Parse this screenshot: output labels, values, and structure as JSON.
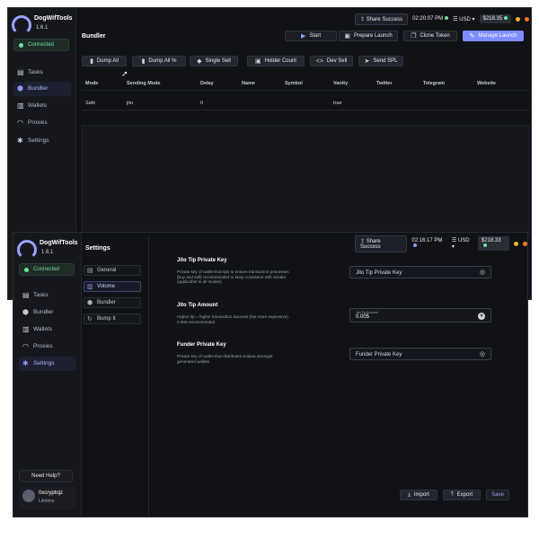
{
  "app": {
    "name": "DogWifTools",
    "version": "1.6.1",
    "status": "Connected",
    "accent": "#7f8cff"
  },
  "window_top": {
    "topbar": {
      "share": "Share Success",
      "clock": "02:20:07 PM",
      "currency": "USD",
      "balance": "$218.35"
    },
    "nav": [
      {
        "label": "Tasks",
        "icon": "tasks-icon"
      },
      {
        "label": "Bundler",
        "icon": "bundler-icon"
      },
      {
        "label": "Wallets",
        "icon": "wallets-icon"
      },
      {
        "label": "Proxies",
        "icon": "proxies-icon"
      },
      {
        "label": "Settings",
        "icon": "settings-icon"
      }
    ],
    "page_title": "Bundler",
    "header_buttons": {
      "start": "Start",
      "prepare": "Prepare Launch",
      "clone": "Clone Token",
      "manage": "Manage Launch"
    },
    "toolbar": {
      "dump_all": "Dump All",
      "dump_all_pct": "Dump All %",
      "single_sell": "Single Sell",
      "holder_count": "Holder Count",
      "dev_sell": "Dev Sell",
      "send_spl": "Send SPL"
    },
    "table": {
      "headers": [
        "Mode",
        "Sending Mode",
        "Delay",
        "Name",
        "Symbol",
        "Vanity",
        "Twitter",
        "Telegram",
        "Website"
      ],
      "rows": [
        [
          "Safe",
          "jito",
          "0",
          "",
          "",
          "true",
          "",
          "",
          ""
        ]
      ]
    }
  },
  "window_bottom": {
    "topbar": {
      "share": "Share Success",
      "clock": "02:16:17 PM",
      "currency": "USD",
      "balance": "$218.33"
    },
    "nav": [
      {
        "label": "Tasks"
      },
      {
        "label": "Bundler"
      },
      {
        "label": "Wallets"
      },
      {
        "label": "Proxies"
      },
      {
        "label": "Settings"
      }
    ],
    "settings_title": "Settings",
    "settings_nav": [
      "General",
      "Volume",
      "Bundler",
      "Bump It"
    ],
    "sections": {
      "jito_key_title": "Jito Tip Private Key",
      "jito_key_desc": "Private key of wallet that tips to ensure transaction processes (buy and sell) recommended to keep consistent with sender (applicable to all modes)",
      "jito_key_placeholder": "Jito Tip Private Key",
      "jito_amount_title": "Jito Tip Amount",
      "jito_amount_desc": "Higher tip = higher transaction success (but more expensive). 0.005 recommended",
      "jito_amount_label": "Jito Tip Amount",
      "jito_amount_value": "0.005",
      "funder_title": "Funder Private Key",
      "funder_desc": "Private key of wallet that distributes Solana amongst generated wallets",
      "funder_placeholder": "Funder Private Key"
    },
    "help": "Need Help?",
    "user": {
      "name": "0xcryptojz",
      "plan": "Lifetime"
    },
    "footer": {
      "import": "Import",
      "export": "Export",
      "save": "Save"
    }
  }
}
